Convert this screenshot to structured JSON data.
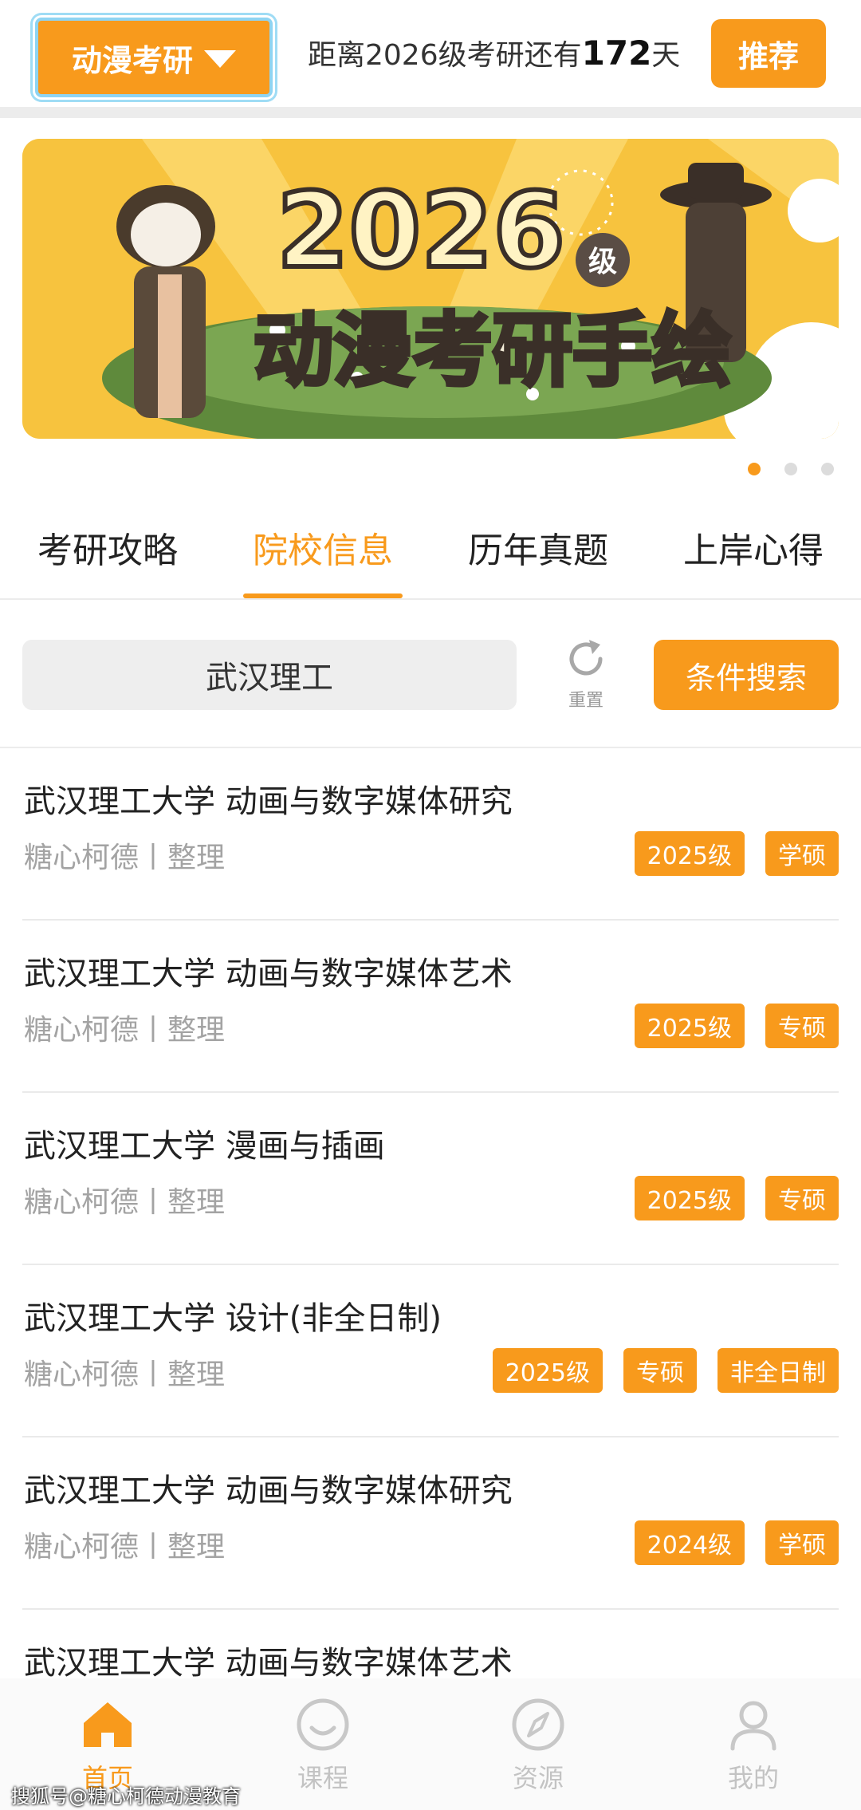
{
  "header": {
    "category_label": "动漫考研",
    "countdown_prefix": "距离2026级考研还有",
    "countdown_days": "172",
    "countdown_suffix": "天",
    "recommend_label": "推荐"
  },
  "banner": {
    "year": "2026",
    "grade_badge": "级",
    "title": "动漫考研手绘",
    "slide_count": 3,
    "active_slide": 1
  },
  "tabs": [
    {
      "label": "考研攻略",
      "active": false
    },
    {
      "label": "院校信息",
      "active": true
    },
    {
      "label": "历年真题",
      "active": false
    },
    {
      "label": "上岸心得",
      "active": false
    }
  ],
  "search": {
    "value": "武汉理工",
    "reset_label": "重置",
    "condition_search_label": "条件搜索"
  },
  "items": [
    {
      "title": "武汉理工大学 动画与数字媒体研究",
      "subtitle": "糖心柯德丨整理",
      "tags": [
        "2025级",
        "学硕"
      ]
    },
    {
      "title": "武汉理工大学  动画与数字媒体艺术",
      "subtitle": "糖心柯德丨整理",
      "tags": [
        "2025级",
        "专硕"
      ]
    },
    {
      "title": "武汉理工大学 漫画与插画",
      "subtitle": "糖心柯德丨整理",
      "tags": [
        "2025级",
        "专硕"
      ]
    },
    {
      "title": "武汉理工大学  设计(非全日制)",
      "subtitle": "糖心柯德丨整理",
      "tags": [
        "2025级",
        "专硕",
        "非全日制"
      ]
    },
    {
      "title": "武汉理工大学 动画与数字媒体研究",
      "subtitle": "糖心柯德丨整理",
      "tags": [
        "2024级",
        "学硕"
      ]
    },
    {
      "title": "武汉理工大学 动画与数字媒体艺术"
    }
  ],
  "bottom_nav": [
    {
      "label": "首页",
      "icon": "home-icon",
      "active": true
    },
    {
      "label": "课程",
      "icon": "smile-icon",
      "active": false
    },
    {
      "label": "资源",
      "icon": "compass-icon",
      "active": false
    },
    {
      "label": "我的",
      "icon": "user-icon",
      "active": false
    }
  ],
  "watermark": "搜狐号@糖心柯德动漫教育",
  "colors": {
    "accent": "#f89a1c",
    "banner_bg": "#f7c33e"
  }
}
